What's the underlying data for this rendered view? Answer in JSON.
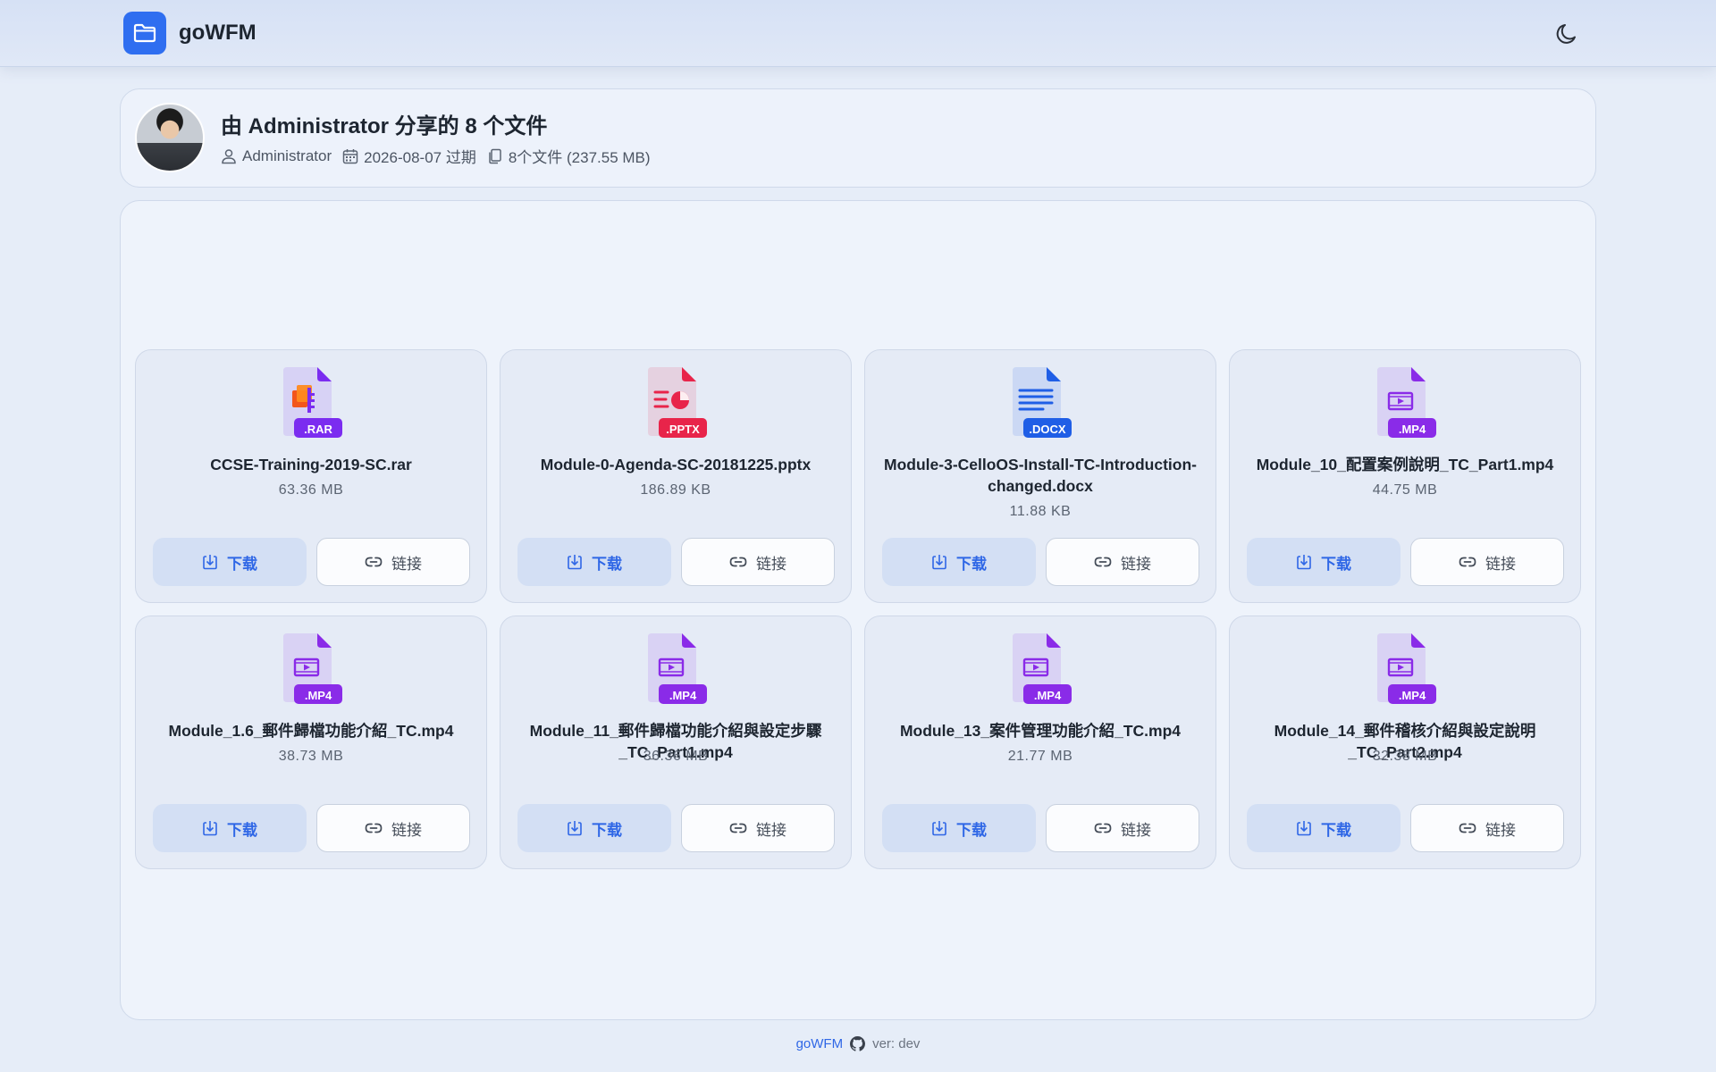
{
  "app": {
    "name": "goWFM"
  },
  "share": {
    "title": "由 Administrator 分享的 8 个文件",
    "owner": "Administrator",
    "expiry": "2026-08-07 过期",
    "summary": "8个文件 (237.55 MB)"
  },
  "actions": {
    "download": "下载",
    "link": "链接"
  },
  "files": [
    {
      "name": "CCSE-Training-2019-SC.rar",
      "size": "63.36 MB",
      "ext": ".RAR",
      "color": "#7b2cf0",
      "icon": "archive-icon"
    },
    {
      "name": "Module-0-Agenda-SC-20181225.pptx",
      "size": "186.89 KB",
      "ext": ".PPTX",
      "color": "#e8244a",
      "icon": "presentation-icon"
    },
    {
      "name": "Module-3-CelloOS-Install-TC-Introduction-changed.docx",
      "size": "11.88 KB",
      "ext": ".DOCX",
      "color": "#1f5ee6",
      "icon": "document-icon"
    },
    {
      "name": "Module_10_配置案例說明_TC_Part1.mp4",
      "size": "44.75 MB",
      "ext": ".MP4",
      "color": "#8a2be8",
      "icon": "video-icon"
    },
    {
      "name": "Module_1.6_郵件歸檔功能介紹_TC.mp4",
      "size": "38.73 MB",
      "ext": ".MP4",
      "color": "#8a2be8",
      "icon": "video-icon"
    },
    {
      "name": "Module_11_郵件歸檔功能介紹與設定步驟_TC_Part1.mp4",
      "size": "36.36 MB",
      "ext": ".MP4",
      "color": "#8a2be8",
      "icon": "video-icon"
    },
    {
      "name": "Module_13_案件管理功能介紹_TC.mp4",
      "size": "21.77 MB",
      "ext": ".MP4",
      "color": "#8a2be8",
      "icon": "video-icon"
    },
    {
      "name": "Module_14_郵件稽核介紹與設定說明_TC_Part2.mp4",
      "size": "32.38 MB",
      "ext": ".MP4",
      "color": "#8a2be8",
      "icon": "video-icon"
    }
  ],
  "footer": {
    "brand": "goWFM",
    "version": "ver: dev"
  }
}
